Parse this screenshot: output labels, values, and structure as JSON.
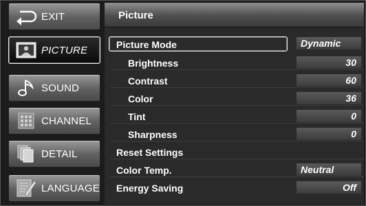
{
  "sidebar": {
    "items": [
      {
        "label": "EXIT",
        "icon": "exit-return-arrow-icon",
        "active": false
      },
      {
        "label": "PICTURE",
        "icon": "picture-frame-person-icon",
        "active": true
      },
      {
        "label": "SOUND",
        "icon": "music-note-icon",
        "active": false
      },
      {
        "label": "CHANNEL",
        "icon": "channel-grid-icon",
        "active": false
      },
      {
        "label": "DETAIL",
        "icon": "stacked-pages-icon",
        "active": false
      },
      {
        "label": "LANGUAGE",
        "icon": "language-document-pen-icon",
        "active": false
      }
    ]
  },
  "main": {
    "title": "Picture",
    "rows": [
      {
        "name": "Picture Mode",
        "value": "Dynamic",
        "selected": true
      },
      {
        "name": "Brightness",
        "value": "30"
      },
      {
        "name": "Contrast",
        "value": "60"
      },
      {
        "name": "Color",
        "value": "36"
      },
      {
        "name": "Tint",
        "value": "0"
      },
      {
        "name": "Sharpness",
        "value": "0"
      },
      {
        "name": "Reset Settings",
        "value": ""
      },
      {
        "name": "Color Temp.",
        "value": "Neutral"
      },
      {
        "name": "Energy Saving",
        "value": "Off"
      }
    ]
  },
  "colors": {
    "background": "#1c1c1c",
    "panel": "#2a2a2a",
    "value_box": "#4a4a4a",
    "text": "#ffffff",
    "highlight_border": "#e8e8e8"
  }
}
